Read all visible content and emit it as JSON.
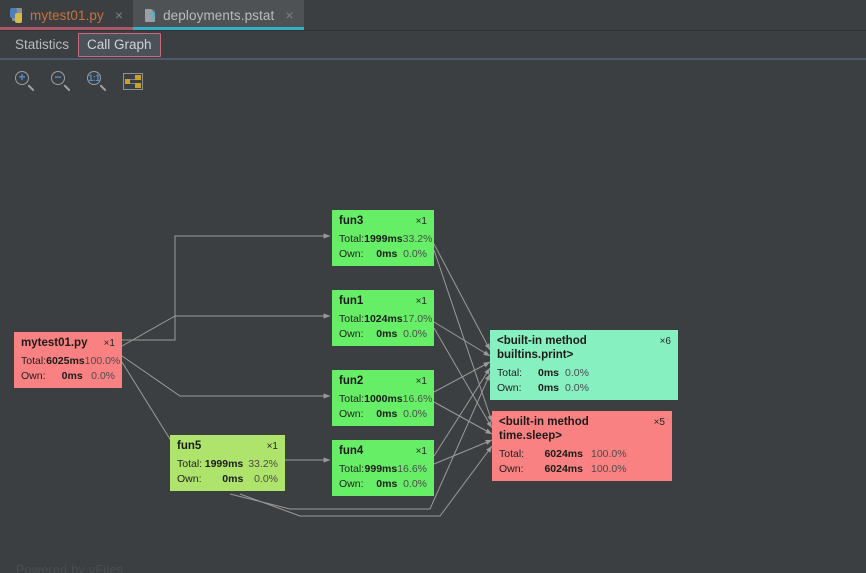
{
  "window": {
    "editor_tabs": [
      {
        "label": "mytest01.py",
        "close": "×",
        "icon": "python-file-icon",
        "active": false
      },
      {
        "label": "deployments.pstat",
        "close": "×",
        "icon": "unknown-file-icon",
        "active": true
      }
    ]
  },
  "subtabs": [
    {
      "label": "Statistics",
      "selected": false
    },
    {
      "label": "Call Graph",
      "selected": true
    }
  ],
  "toolbar": {
    "zoom_in": "zoom-in",
    "zoom_out": "zoom-out",
    "zoom_actual": "1:1",
    "fit_graph": "fit-content"
  },
  "graph": {
    "watermark": "Powered by yFiles",
    "labels": {
      "total": "Total:",
      "own": "Own:"
    },
    "nodes": [
      {
        "id": "mytest01",
        "title": "mytest01.py",
        "count": "×1",
        "total_value": "6025ms",
        "total_pct": "100.0%",
        "own_value": "0ms",
        "own_pct": "0.0%",
        "color": "#fa8181"
      },
      {
        "id": "fun3",
        "title": "fun3",
        "count": "×1",
        "total_value": "1999ms",
        "total_pct": "33.2%",
        "own_value": "0ms",
        "own_pct": "0.0%",
        "color": "#66ee66"
      },
      {
        "id": "fun1",
        "title": "fun1",
        "count": "×1",
        "total_value": "1024ms",
        "total_pct": "17.0%",
        "own_value": "0ms",
        "own_pct": "0.0%",
        "color": "#66ee66"
      },
      {
        "id": "fun2",
        "title": "fun2",
        "count": "×1",
        "total_value": "1000ms",
        "total_pct": "16.6%",
        "own_value": "0ms",
        "own_pct": "0.0%",
        "color": "#66ee66"
      },
      {
        "id": "fun5",
        "title": "fun5",
        "count": "×1",
        "total_value": "1999ms",
        "total_pct": "33.2%",
        "own_value": "0ms",
        "own_pct": "0.0%",
        "color": "#aee46b"
      },
      {
        "id": "fun4",
        "title": "fun4",
        "count": "×1",
        "total_value": "999ms",
        "total_pct": "16.6%",
        "own_value": "0ms",
        "own_pct": "0.0%",
        "color": "#66ee66"
      },
      {
        "id": "print",
        "title": "<built-in method builtins.print>",
        "count": "×6",
        "total_value": "0ms",
        "total_pct": "0.0%",
        "own_value": "0ms",
        "own_pct": "0.0%",
        "color": "#87f0c0"
      },
      {
        "id": "sleep",
        "title": "<built-in method time.sleep>",
        "count": "×5",
        "total_value": "6024ms",
        "total_pct": "100.0%",
        "own_value": "6024ms",
        "own_pct": "100.0%",
        "color": "#fa8181"
      }
    ]
  }
}
